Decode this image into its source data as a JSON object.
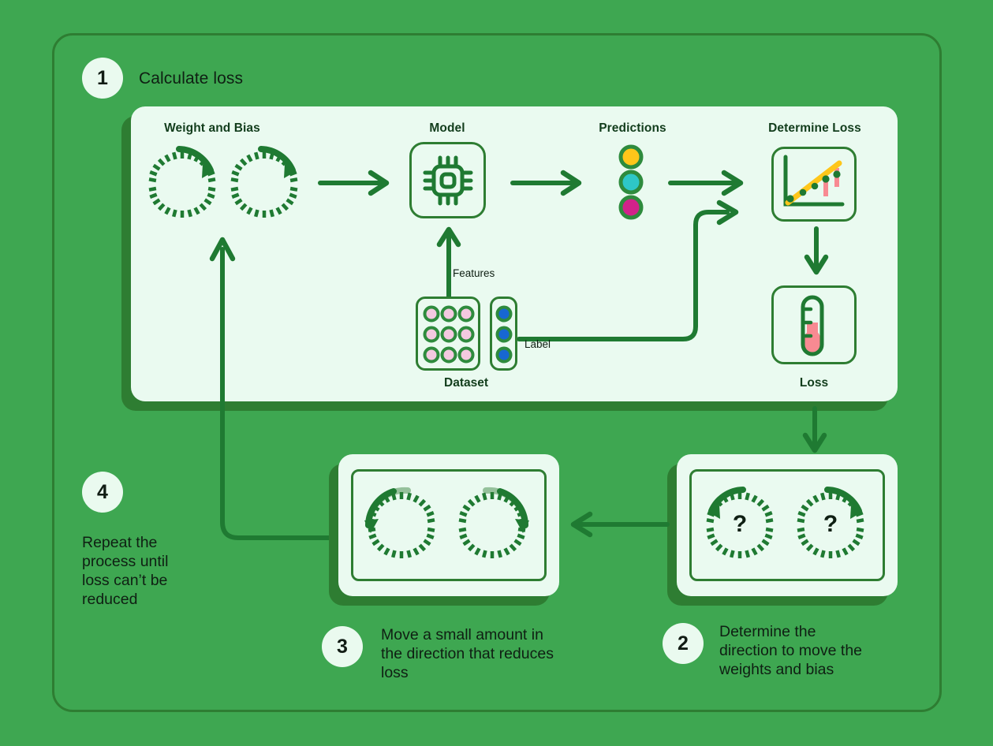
{
  "colors": {
    "background": "#3ea751",
    "panel_bg": "#eafaf0",
    "dark_green": "#2e7d32",
    "line_green": "#1f7a32",
    "text_dark": "#0f1f13",
    "yellow": "#ffc61a",
    "cyan": "#2ec7c7",
    "magenta": "#d2228a",
    "pink": "#f88a92",
    "dataset_pink": "#f4c9e0",
    "label_blue": "#1767d2"
  },
  "steps": [
    {
      "number": "1",
      "title": "Calculate loss",
      "description": ""
    },
    {
      "number": "2",
      "title": "",
      "description": "Determine the direction to move the weights and bias"
    },
    {
      "number": "3",
      "title": "",
      "description": "Move a small amount in the direction that reduces loss"
    },
    {
      "number": "4",
      "title": "",
      "description": "Repeat the process until loss can’t be reduced"
    }
  ],
  "step1": {
    "sections": {
      "weight_and_bias": "Weight and Bias",
      "model": "Model",
      "predictions": "Predictions",
      "determine_loss": "Determine Loss"
    },
    "captions": {
      "dataset": "Dataset",
      "loss": "Loss"
    },
    "edge_labels": {
      "features": "Features",
      "label": "Label"
    },
    "icons": {
      "weight_dial": "dial-rotate-icon",
      "bias_dial": "dial-rotate-icon",
      "model": "cpu-chip-icon",
      "determine_loss": "scatter-plot-regression-icon",
      "loss": "thermometer-icon"
    },
    "predictions_dots": [
      "yellow",
      "cyan",
      "magenta"
    ],
    "dataset": {
      "feature_rows": 3,
      "feature_cols": 3,
      "feature_count": 9,
      "label_count": 3
    }
  },
  "step2_box": {
    "dials": [
      {
        "mark": "?",
        "direction": "counter-clockwise"
      },
      {
        "mark": "?",
        "direction": "clockwise"
      }
    ]
  },
  "step3_box": {
    "dials": [
      {
        "mark": "",
        "direction": "counter-clockwise"
      },
      {
        "mark": "",
        "direction": "clockwise"
      }
    ]
  },
  "chart_data": {
    "type": "scatter",
    "title": "Determine Loss",
    "x": [
      1,
      2,
      3,
      4,
      5
    ],
    "y": [
      0.6,
      1.3,
      2.1,
      2.9,
      3.4
    ],
    "fit_line": {
      "type": "linear",
      "color": "#ffc61a"
    },
    "residuals": [
      0,
      0,
      0,
      0.7,
      1.1
    ],
    "residual_color": "#f88a92",
    "point_color": "#1f7a32",
    "xlabel": "",
    "ylabel": "",
    "grid": false,
    "legend": "none"
  }
}
